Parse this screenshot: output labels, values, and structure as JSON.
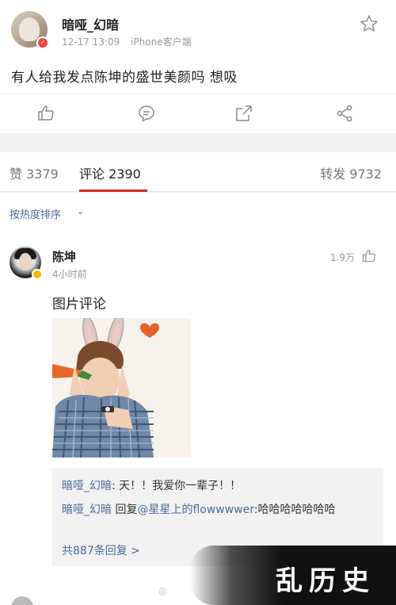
{
  "post": {
    "username": "暗哑_幻暗",
    "time": "12-17 13:09",
    "source": "iPhone客户端",
    "text": "有人给我发点陈坤的盛世美颜吗 想吸"
  },
  "tabs": {
    "likes": "赞 3379",
    "comments": "评论 2390",
    "reposts": "转发 9732"
  },
  "sort": {
    "label": "按热度排序",
    "arrow": "⌄"
  },
  "comment": {
    "name": "陈坤",
    "time": "4小时前",
    "likes": "1.9万",
    "text": "图片评论",
    "replies": [
      {
        "who": "暗哑_幻暗",
        "sep": ": ",
        "text": "天！！我爱你一辈子！！"
      },
      {
        "who": "暗哑_幻暗",
        "mid": " 回复",
        "at": "@星星上的flowwwwer",
        "text": ":哈哈哈哈哈哈哈"
      }
    ],
    "more": "共887条回复 >"
  },
  "watermark": {
    "text": "乱历史"
  },
  "colors": {
    "accent": "#c9302c",
    "link": "#4a6a9a",
    "vip": "#e8453c"
  },
  "icons": {
    "like": "thumb-up-icon",
    "comment": "comment-icon",
    "repost": "share-out-icon",
    "share": "share-icon",
    "favorite": "star-icon"
  }
}
